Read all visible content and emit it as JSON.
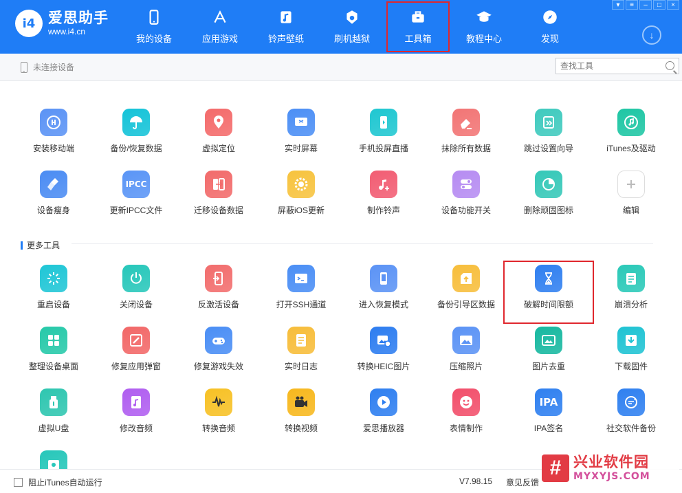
{
  "app": {
    "logo_mark": "i4",
    "logo_name": "爱思助手",
    "logo_url": "www.i4.cn"
  },
  "nav": [
    {
      "label": "我的设备",
      "icon": "phone-icon"
    },
    {
      "label": "应用游戏",
      "icon": "app-store-icon"
    },
    {
      "label": "铃声壁纸",
      "icon": "music-file-icon"
    },
    {
      "label": "刷机越狱",
      "icon": "flash-box-icon"
    },
    {
      "label": "工具箱",
      "icon": "toolbox-icon",
      "active": true
    },
    {
      "label": "教程中心",
      "icon": "graduation-cap-icon"
    },
    {
      "label": "发现",
      "icon": "compass-icon"
    }
  ],
  "window_controls": [
    "shirt-icon",
    "settings-icon",
    "minimize-icon",
    "maximize-icon",
    "close-icon"
  ],
  "subbar": {
    "device_status": "未连接设备",
    "search_placeholder": "查找工具"
  },
  "tools_main": [
    {
      "label": "安装移动端",
      "color": "#5b93f5",
      "icon": "i4-app-icon"
    },
    {
      "label": "备份/恢复数据",
      "color": "#14c3d8",
      "icon": "umbrella-icon"
    },
    {
      "label": "虚拟定位",
      "color": "#f46b6b",
      "icon": "location-pin-icon"
    },
    {
      "label": "实时屏幕",
      "color": "#4c8ff5",
      "icon": "screen-icon"
    },
    {
      "label": "手机投屏直播",
      "color": "#1fc7d1",
      "icon": "phone-cast-icon"
    },
    {
      "label": "抹除所有数据",
      "color": "#f27575",
      "icon": "eraser-icon"
    },
    {
      "label": "跳过设置向导",
      "color": "#3fcabe",
      "icon": "skip-wizard-icon"
    },
    {
      "label": "iTunes及驱动",
      "color": "#1ec6a4",
      "icon": "itunes-icon"
    },
    {
      "label": "设备瘦身",
      "color": "#4b8cf3",
      "icon": "broom-icon"
    },
    {
      "label": "更新IPCC文件",
      "color": "#5a95f6",
      "icon": "ipcc-icon",
      "text": "IPCC"
    },
    {
      "label": "迁移设备数据",
      "color": "#f26b6b",
      "icon": "migrate-icon"
    },
    {
      "label": "屏蔽iOS更新",
      "color": "#f7c33e",
      "icon": "gear-block-icon"
    },
    {
      "label": "制作铃声",
      "color": "#f25d73",
      "icon": "ringtone-icon"
    },
    {
      "label": "设备功能开关",
      "color": "#b68cf2",
      "icon": "toggle-icon"
    },
    {
      "label": "删除顽固图标",
      "color": "#35c8b8",
      "icon": "pie-icon"
    },
    {
      "label": "编辑",
      "color": "#ffffff",
      "icon": "plus-icon"
    }
  ],
  "section_title": "更多工具",
  "tools_more": [
    {
      "label": "重启设备",
      "color": "#1fc6d6",
      "icon": "restart-icon"
    },
    {
      "label": "关闭设备",
      "color": "#27c7ba",
      "icon": "power-icon"
    },
    {
      "label": "反激活设备",
      "color": "#f26d6d",
      "icon": "deactivate-icon"
    },
    {
      "label": "打开SSH通道",
      "color": "#4a8ef5",
      "icon": "terminal-icon"
    },
    {
      "label": "进入恢复模式",
      "color": "#5b93f5",
      "icon": "recovery-icon"
    },
    {
      "label": "备份引导区数据",
      "color": "#f7be3c",
      "icon": "boot-backup-icon"
    },
    {
      "label": "破解时间限额",
      "color": "#2f7ff0",
      "icon": "hourglass-icon",
      "highlight": true
    },
    {
      "label": "崩溃分析",
      "color": "#2ac9b8",
      "icon": "crash-report-icon"
    },
    {
      "label": "整理设备桌面",
      "color": "#26c9a9",
      "icon": "grid-icon"
    },
    {
      "label": "修复应用弹窗",
      "color": "#f26868",
      "icon": "repair-icon"
    },
    {
      "label": "修复游戏失效",
      "color": "#4a8ef5",
      "icon": "gamepad-icon"
    },
    {
      "label": "实时日志",
      "color": "#f7bd3a",
      "icon": "log-icon"
    },
    {
      "label": "转换HEIC图片",
      "color": "#2d7df0",
      "icon": "heic-convert-icon"
    },
    {
      "label": "压缩照片",
      "color": "#5b93f5",
      "icon": "image-compress-icon"
    },
    {
      "label": "图片去重",
      "color": "#17b8a0",
      "icon": "image-dedupe-icon"
    },
    {
      "label": "下载固件",
      "color": "#1fc3d3",
      "icon": "firmware-download-icon"
    },
    {
      "label": "虚拟U盘",
      "color": "#2ec6b0",
      "icon": "usb-drive-icon"
    },
    {
      "label": "修改音频",
      "color": "#b05ef0",
      "icon": "audio-edit-icon"
    },
    {
      "label": "转换音频",
      "color": "#f7c125",
      "icon": "audio-wave-icon"
    },
    {
      "label": "转换视频",
      "color": "#f7b81e",
      "icon": "video-camera-icon"
    },
    {
      "label": "爱思播放器",
      "color": "#2f7ff0",
      "icon": "play-icon"
    },
    {
      "label": "表情制作",
      "color": "#f24f6b",
      "icon": "emoji-icon"
    },
    {
      "label": "IPA签名",
      "color": "#2f80f0",
      "icon": "ipa-icon",
      "text": "IPA"
    },
    {
      "label": "社交软件备份",
      "color": "#2f80f0",
      "icon": "social-backup-icon"
    },
    {
      "label": "",
      "color": "#27c7ba",
      "icon": "partial-tool-icon"
    }
  ],
  "footer": {
    "checkbox_label": "阻止iTunes自动运行",
    "version": "V7.98.15",
    "feedback": "意见反馈"
  },
  "watermark": {
    "mark": "#",
    "cn": "兴业软件园",
    "en": "MYXYJS.COM"
  }
}
